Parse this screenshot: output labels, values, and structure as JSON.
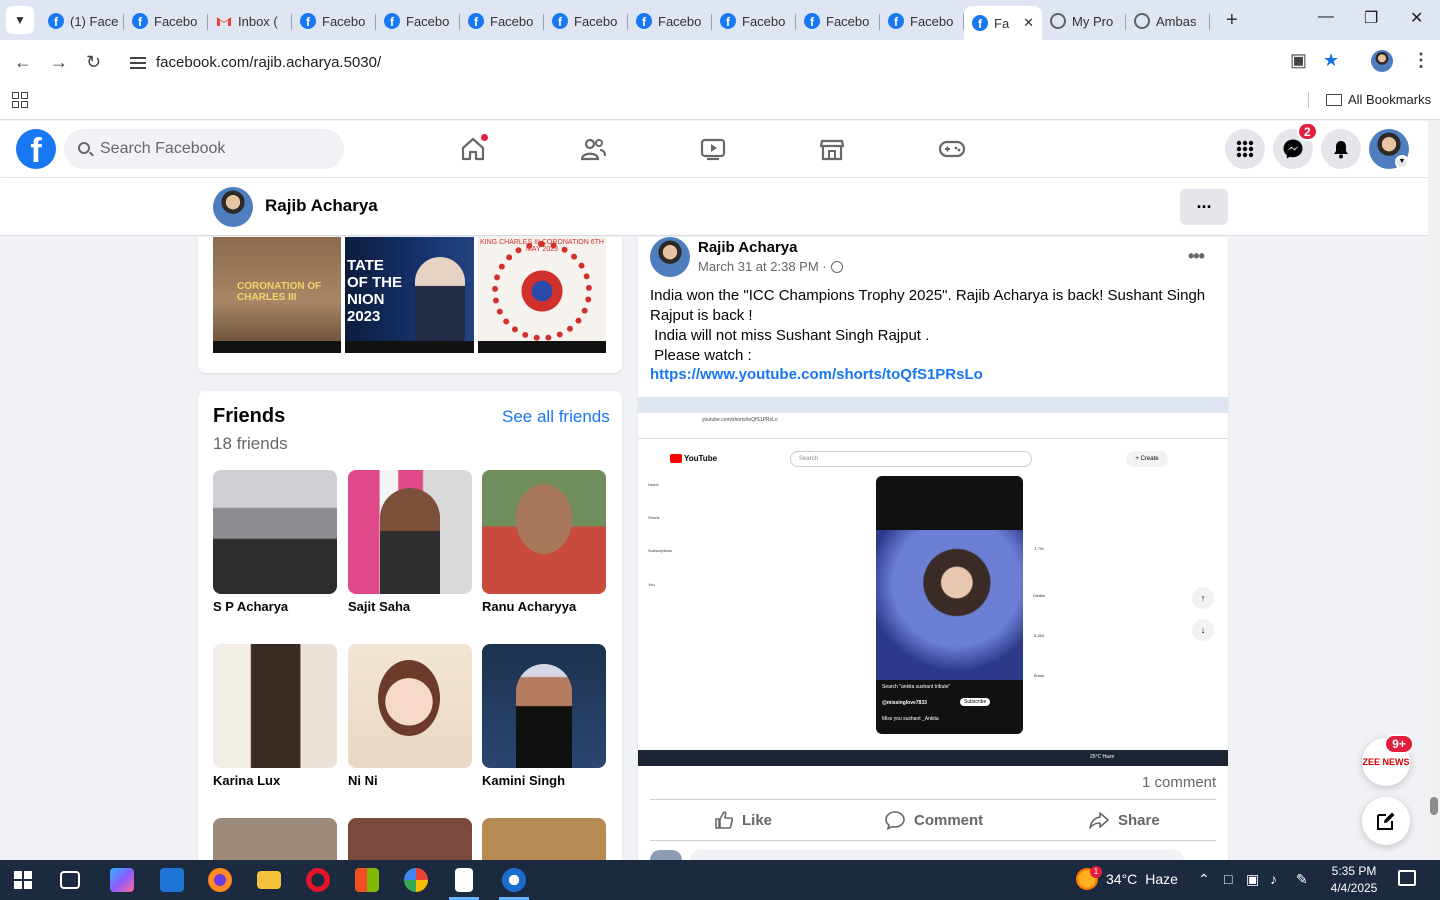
{
  "browser": {
    "tabs": [
      {
        "label": "(1) Face",
        "icon": "facebook-icon"
      },
      {
        "label": "Facebo",
        "icon": "facebook-icon"
      },
      {
        "label": "Inbox (",
        "icon": "gmail-icon"
      },
      {
        "label": "Facebo",
        "icon": "facebook-icon"
      },
      {
        "label": "Facebo",
        "icon": "facebook-icon"
      },
      {
        "label": "Facebo",
        "icon": "facebook-icon"
      },
      {
        "label": "Facebo",
        "icon": "facebook-icon"
      },
      {
        "label": "Facebo",
        "icon": "facebook-icon"
      },
      {
        "label": "Facebo",
        "icon": "facebook-icon"
      },
      {
        "label": "Facebo",
        "icon": "facebook-icon"
      },
      {
        "label": "Facebo",
        "icon": "facebook-icon"
      }
    ],
    "active_tab": {
      "label": "Fa",
      "icon": "facebook-icon"
    },
    "after_tabs": [
      {
        "label": "My Pro",
        "icon": "globe-icon"
      },
      {
        "label": "Ambas",
        "icon": "globe-icon"
      }
    ],
    "url": "facebook.com/rajib.acharya.5030/",
    "all_bookmarks": "All Bookmarks"
  },
  "facebook": {
    "search_placeholder": "Search Facebook",
    "messenger_badge": "2",
    "colors": {
      "brand": "#1877f2",
      "badge": "#e41e3f"
    }
  },
  "profile": {
    "name": "Rajib Acharya",
    "more_label": "···"
  },
  "photos": [
    {
      "caption": "CORONATION OF CHARLES III"
    },
    {
      "caption": "TATE OF THE NION 2023"
    },
    {
      "caption": "KING CHARLES III CORONATION 6TH MAY 2023"
    }
  ],
  "friends": {
    "title": "Friends",
    "count": "18 friends",
    "see_all": "See all friends",
    "items": [
      {
        "name": "S P Acharya"
      },
      {
        "name": "Sajit Saha"
      },
      {
        "name": "Ranu Acharyya"
      },
      {
        "name": "Karina Lux"
      },
      {
        "name": "Ni Ni"
      },
      {
        "name": "Kamini Singh"
      }
    ]
  },
  "post": {
    "author": "Rajib Acharya",
    "date": "March 31 at 2:38 PM ·",
    "text_lines": [
      "India won the \"ICC Champions Trophy 2025\". Rajib Acharya is back! Sushant Singh Rajput is back !",
      " India will not miss Sushant Singh Rajput .",
      " Please watch :"
    ],
    "link": "https://www.youtube.com/shorts/toQfS1PRsLo",
    "screenshot": {
      "url": "youtube.com/shorts/toQfS1PRsLo",
      "search": "Search",
      "create": "+ Create",
      "yt_logo": "YouTube",
      "sidebar": [
        "Home",
        "Shorts",
        "Subscriptions",
        "You"
      ],
      "likes": "1.7M",
      "dislike": "Dislike",
      "comments": "6,284",
      "share": "Share",
      "channel": "@missinglove7833",
      "subscribe": "Subscribe",
      "caption": "Miss you sushant _Ankita",
      "search_hint": "Search \"ankita sushant tribute\"",
      "weather": "25°C Haze"
    },
    "comments_count": "1 comment",
    "actions": {
      "like": "Like",
      "comment": "Comment",
      "share": "Share"
    }
  },
  "floating": {
    "news_badge": "9+",
    "news_label": "ZEE NEWS"
  },
  "taskbar": {
    "weather": {
      "temp": "34°C",
      "condition": "Haze",
      "alert": "1"
    },
    "time": "5:35 PM",
    "date": "4/4/2025"
  }
}
